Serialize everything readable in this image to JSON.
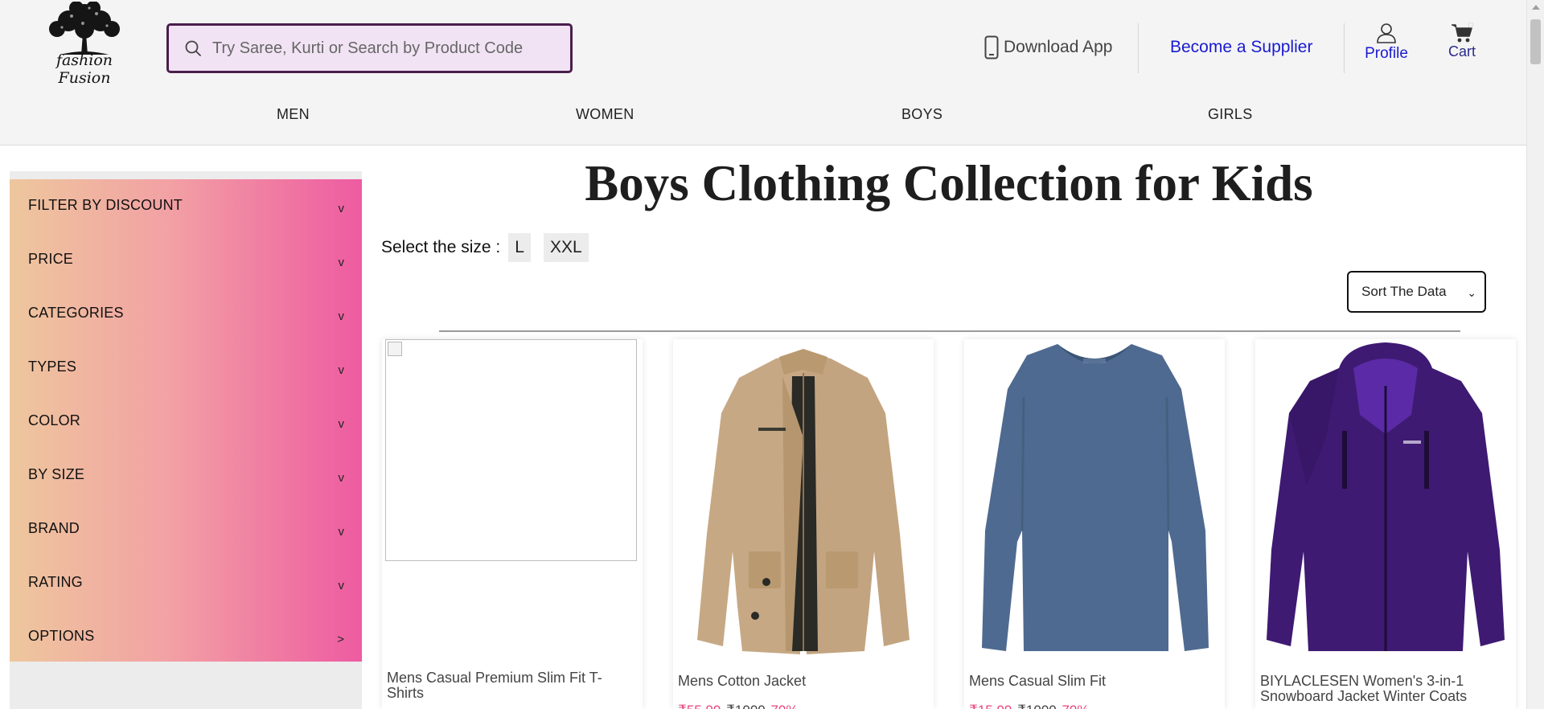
{
  "brand": {
    "logo_text": "fashion Fusion"
  },
  "search": {
    "placeholder": "Try Saree, Kurti or Search by Product Code"
  },
  "header": {
    "download_app": "Download App",
    "become_supplier": "Become a Supplier",
    "profile": "Profile",
    "cart": "Cart"
  },
  "nav": [
    "MEN",
    "WOMEN",
    "BOYS",
    "GIRLS"
  ],
  "filters": [
    {
      "label": "FILTER BY DISCOUNT",
      "chevron": "v"
    },
    {
      "label": "PRICE",
      "chevron": "v"
    },
    {
      "label": "CATEGORIES",
      "chevron": "v"
    },
    {
      "label": "TYPES",
      "chevron": "v"
    },
    {
      "label": "COLOR",
      "chevron": "v"
    },
    {
      "label": "BY SIZE",
      "chevron": "v"
    },
    {
      "label": "BRAND",
      "chevron": "v"
    },
    {
      "label": "RATING",
      "chevron": "v"
    },
    {
      "label": "OPTIONS",
      "chevron": ">"
    }
  ],
  "page": {
    "title": "Boys Clothing Collection for Kids",
    "size_label": "Select the size :",
    "sizes": [
      "L",
      "XXL"
    ],
    "sort_label": "Sort The Data"
  },
  "products": [
    {
      "name": "Mens Casual Premium Slim Fit T-Shirts",
      "image": "broken-image",
      "price": "",
      "old_price": "",
      "discount": ""
    },
    {
      "name": "Mens Cotton Jacket",
      "image": "khaki-jacket",
      "price": "₹55.99",
      "old_price": "₹1000",
      "discount": "70%"
    },
    {
      "name": "Mens Casual Slim Fit",
      "image": "blue-longsleeve-tshirt",
      "price": "₹15.99",
      "old_price": "₹1000",
      "discount": "70%"
    },
    {
      "name": "BIYLACLESEN Women's 3-in-1 Snowboard Jacket Winter Coats",
      "image": "purple-snowboard-jacket",
      "price": "",
      "old_price": "",
      "discount": ""
    }
  ],
  "colors": {
    "accent_pink": "#ee5ba1",
    "accent_peach": "#eec79d",
    "link_blue": "#1a1ad0",
    "search_border": "#4a1e4c",
    "search_bg": "#f1e3f4",
    "price_pink": "#e8447a"
  }
}
